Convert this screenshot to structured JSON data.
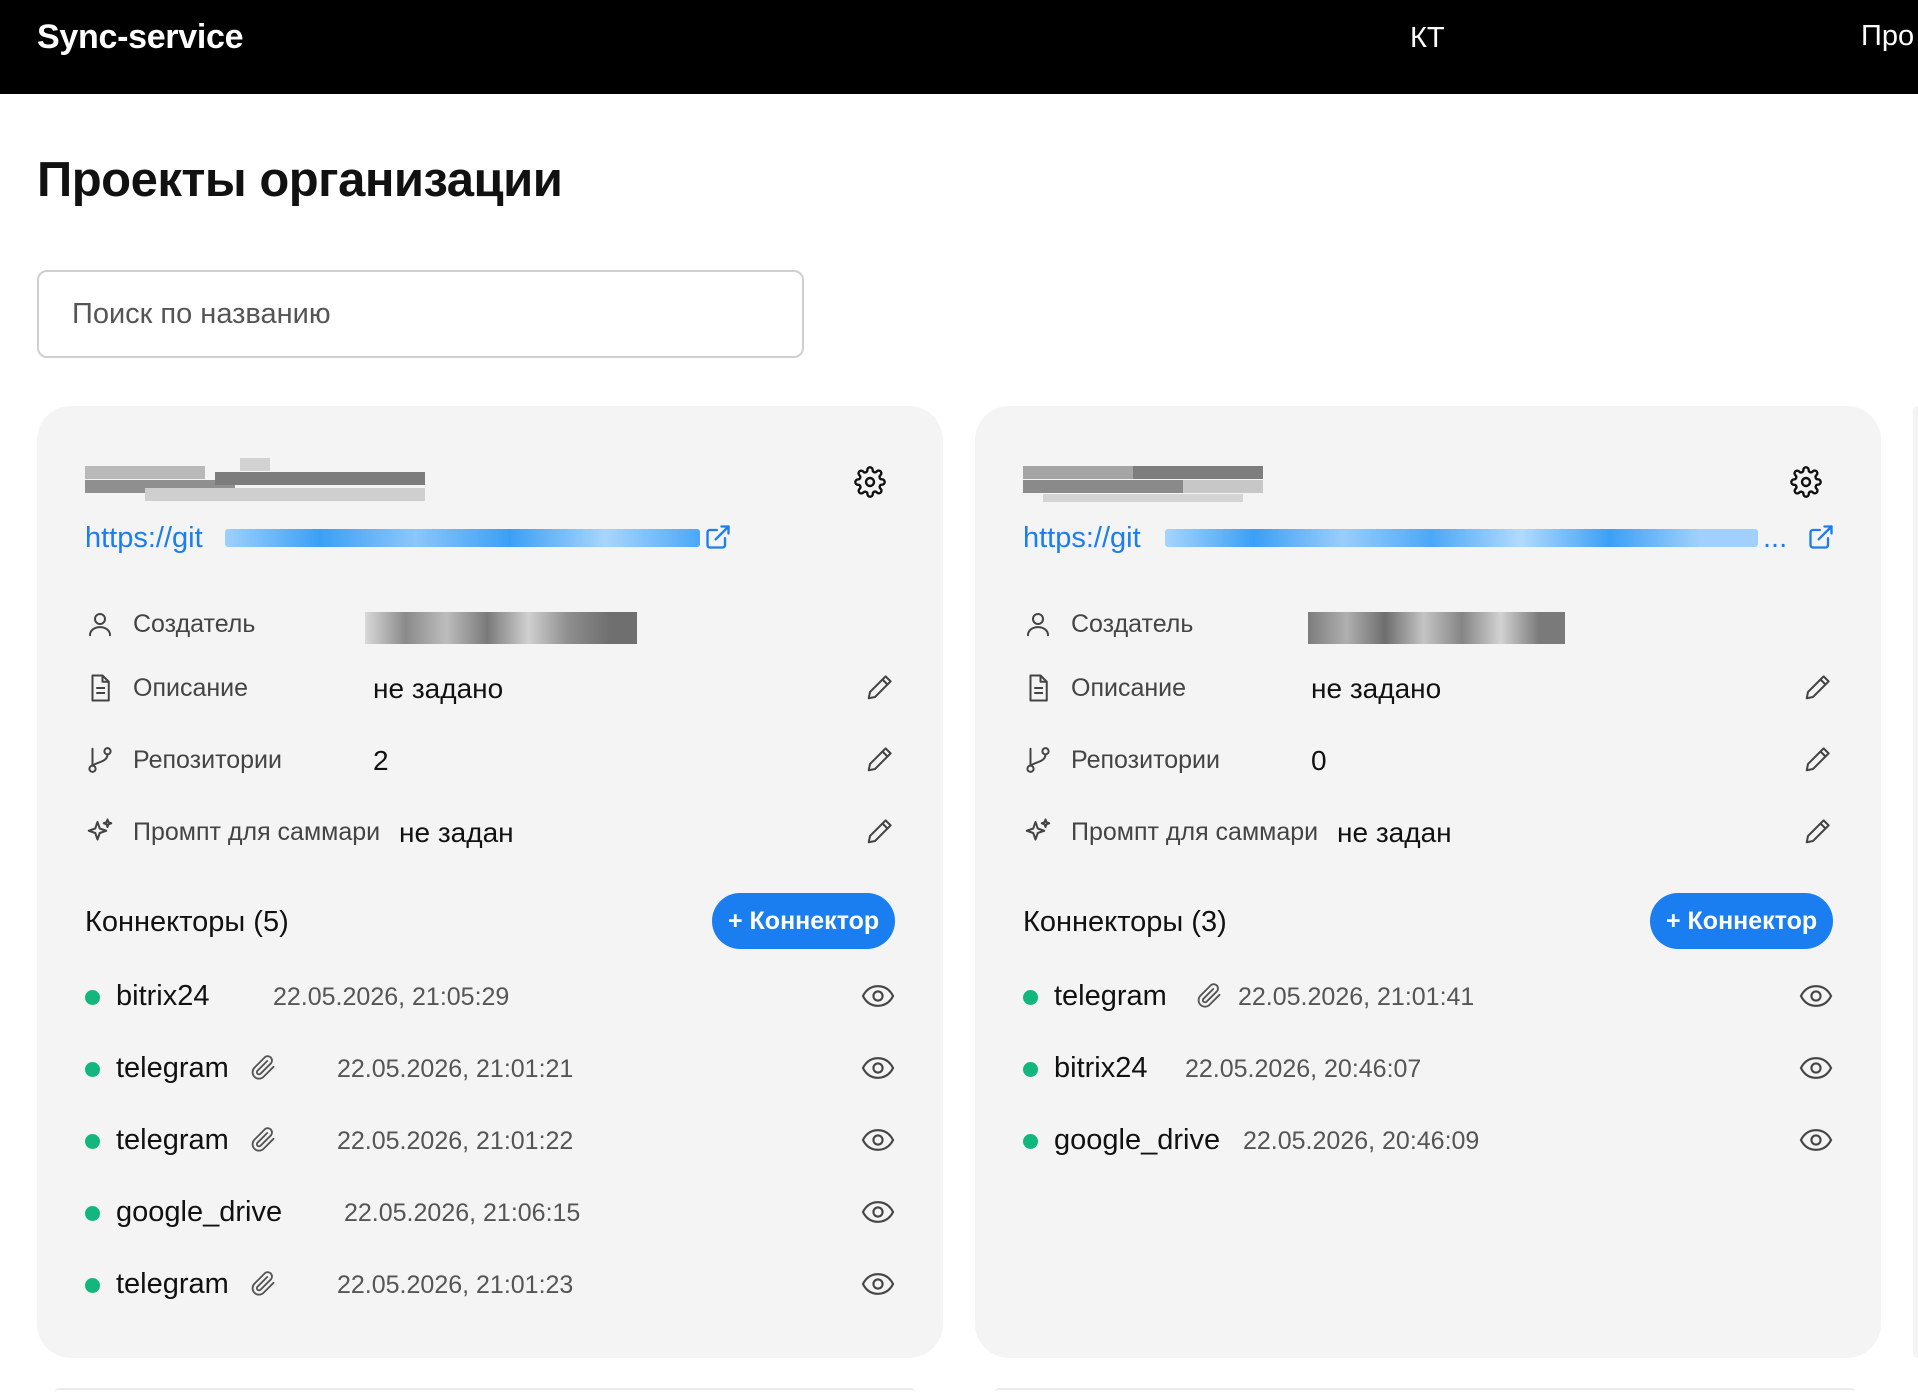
{
  "header": {
    "brand": "Sync-service",
    "nav_kt": "КТ",
    "nav_pro": "Про"
  },
  "page_title": "Проекты организации",
  "search": {
    "placeholder": "Поиск по названию",
    "value": ""
  },
  "labels": {
    "creator": "Создатель",
    "description": "Описание",
    "repositories": "Репозитории",
    "prompt": "Промпт для саммари",
    "add_connector": "+ Коннектор"
  },
  "projects": [
    {
      "link_prefix": "https://git",
      "description": "не задано",
      "repositories": "2",
      "prompt": "не задан",
      "connectors_title": "Коннекторы (5)",
      "connectors": [
        {
          "name": "bitrix24",
          "timestamp": "22.05.2026, 21:05:29",
          "attachment": false,
          "status_color": "#12b77e"
        },
        {
          "name": "telegram",
          "timestamp": "22.05.2026, 21:01:21",
          "attachment": true,
          "status_color": "#12b77e"
        },
        {
          "name": "telegram",
          "timestamp": "22.05.2026, 21:01:22",
          "attachment": true,
          "status_color": "#12b77e"
        },
        {
          "name": "google_drive",
          "timestamp": "22.05.2026, 21:06:15",
          "attachment": false,
          "status_color": "#12b77e"
        },
        {
          "name": "telegram",
          "timestamp": "22.05.2026, 21:01:23",
          "attachment": true,
          "status_color": "#12b77e"
        }
      ]
    },
    {
      "link_prefix": "https://git",
      "link_suffix": "...",
      "description": "не задано",
      "repositories": "0",
      "prompt": "не задан",
      "connectors_title": "Коннекторы (3)",
      "connectors": [
        {
          "name": "telegram",
          "timestamp": "22.05.2026, 21:01:41",
          "attachment": true,
          "status_color": "#12b77e"
        },
        {
          "name": "bitrix24",
          "timestamp": "22.05.2026, 20:46:07",
          "attachment": false,
          "status_color": "#12b77e"
        },
        {
          "name": "google_drive",
          "timestamp": "22.05.2026, 20:46:09",
          "attachment": false,
          "status_color": "#12b77e"
        }
      ]
    }
  ],
  "colors": {
    "accent": "#1a7df0",
    "status_ok": "#12b77e",
    "card_bg": "#f4f4f4",
    "header_bg": "#000000"
  },
  "icons": [
    "gear-icon",
    "external-link-icon",
    "user-icon",
    "document-icon",
    "branch-icon",
    "sparkle-icon",
    "pencil-icon",
    "paperclip-icon",
    "eye-icon"
  ]
}
